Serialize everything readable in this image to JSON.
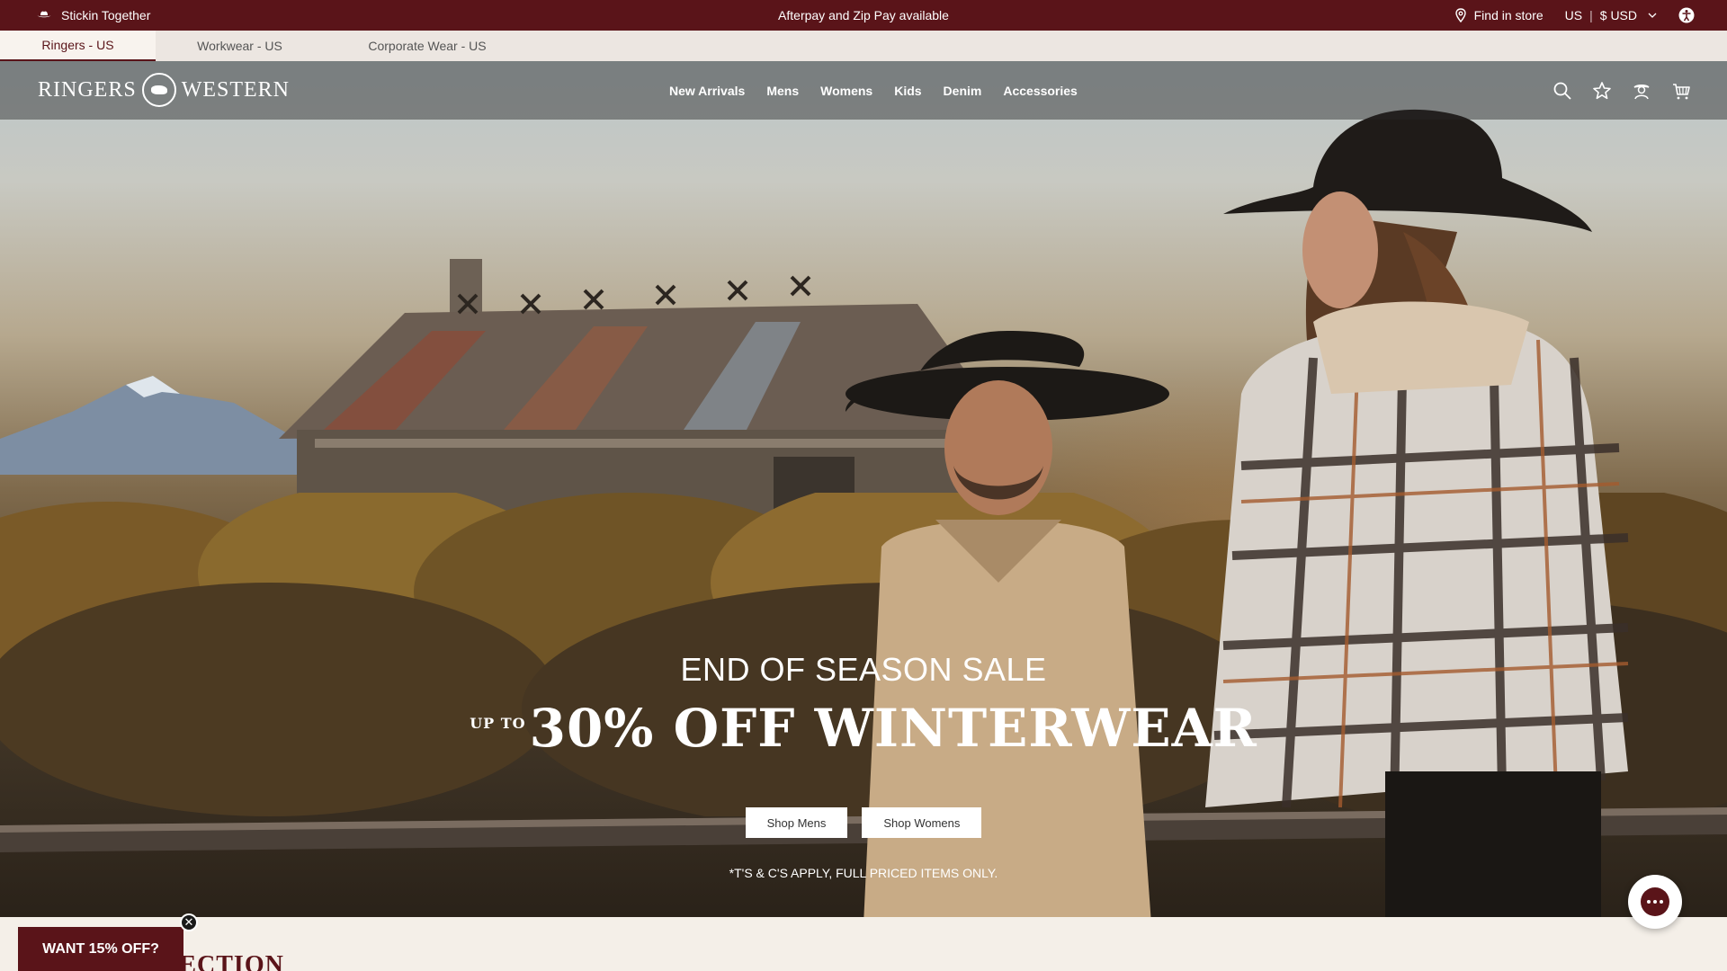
{
  "announcement": {
    "left_text": "Stickin Together",
    "center_text": "Afterpay and Zip Pay available",
    "find_store": "Find in store",
    "country": "US",
    "currency": "$ USD"
  },
  "brand_tabs": [
    {
      "label": "Ringers - US",
      "active": true
    },
    {
      "label": "Workwear - US",
      "active": false
    },
    {
      "label": "Corporate Wear - US",
      "active": false
    }
  ],
  "header": {
    "logo_left": "RINGERS",
    "logo_right": "WESTERN",
    "nav": [
      "New Arrivals",
      "Mens",
      "Womens",
      "Kids",
      "Denim",
      "Accessories"
    ],
    "icons": [
      "search-icon",
      "star-icon",
      "account-icon",
      "cart-icon"
    ]
  },
  "hero": {
    "subtitle": "END OF SEASON SALE",
    "upto": "UP TO",
    "headline": "30% OFF WINTERWEAR",
    "cta_mens": "Shop Mens",
    "cta_womens": "Shop Womens",
    "terms": "*T'S & C'S APPLY, FULL PRICED ITEMS ONLY."
  },
  "collection_heading": "LLECTION",
  "discount_popup": {
    "label": "WANT 15% OFF?",
    "close": "✕"
  },
  "colors": {
    "brand": "#5a1419",
    "tab_bar": "#ece6e1"
  }
}
